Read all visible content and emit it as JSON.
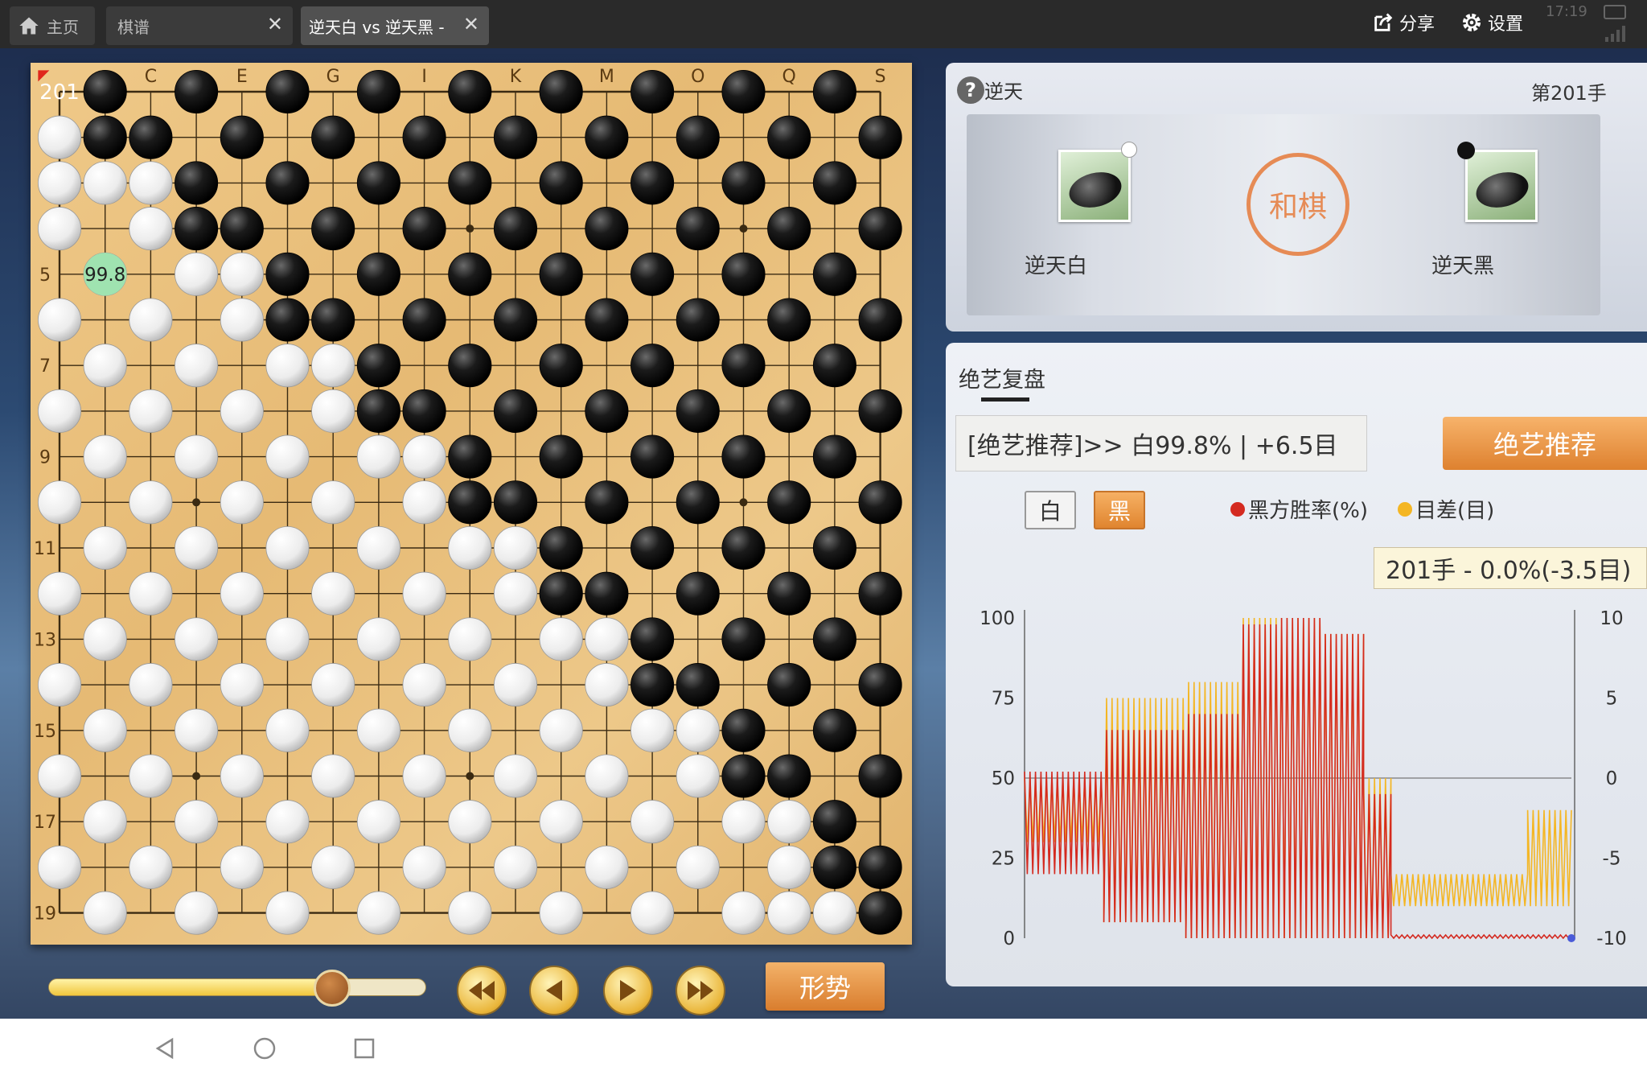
{
  "tabs": [
    {
      "label": "主页"
    },
    {
      "label": "棋谱"
    },
    {
      "label": "逆天白 vs 逆天黑 -"
    }
  ],
  "topbar": {
    "share_label": "分享",
    "settings_label": "设置",
    "clock": "17:19"
  },
  "board": {
    "col_labels": [
      "C",
      "E",
      "G",
      "I",
      "K",
      "M",
      "O",
      "Q",
      "S"
    ],
    "row_labels": [
      "5",
      "7",
      "9",
      "11",
      "13",
      "15",
      "17",
      "19"
    ],
    "move_number_label": "201",
    "winrate_marker": "99.8",
    "winrate_marker_point": "B5",
    "rows": [
      ".B.B.B.B.B.B.B.B.B.",
      "WBB.B.B.B.B.B.B.B.B",
      "WWWB.B.B.B.B.B.B.B.",
      "W.WBB.B.B.B.B.B.B.B",
      ".W.WWB.B.B.B.B.B.B.",
      "W.W.WBB.B.B.B.B.B.B",
      ".W.W.WWB.B.B.B.B.B.",
      "W.W.W.WBB.B.B.B.B.B",
      ".W.W.W.WWB.B.B.B.B.",
      "W.W.W.W.WBB.B.B.B.B",
      ".W.W.W.W.WWB.B.B.B.",
      "W.W.W.W.W.WBB.B.B.B",
      ".W.W.W.W.W.WWB.B.B.",
      "W.W.W.W.W.W.WBB.B.B",
      ".W.W.W.W.W.W.WWB.B.",
      "W.W.W.W.W.W.W.WBB.B",
      ".W.W.W.W.W.W.W.WWB.",
      "W.W.W.W.W.W.W.W.WBB",
      ".W.W.W.W.W.W.W.WWWB"
    ]
  },
  "info": {
    "help_label": "逆天",
    "move_label": "第201手",
    "white_player": "逆天白",
    "black_player": "逆天黑",
    "result": "和棋"
  },
  "playback": {
    "progress": 0.75,
    "trend_label": "形势"
  },
  "review": {
    "title": "绝艺复盘",
    "recommend_text": "[绝艺推荐]>> 白99.8% | +6.5目",
    "recommend_button": "绝艺推荐",
    "white_button": "白",
    "black_button": "黑",
    "legend_winrate": "黑方胜率(%)",
    "legend_diff": "目差(目)",
    "tooltip": "201手 - 0.0%(-3.5目)"
  },
  "chart_data": {
    "type": "line",
    "y_left": {
      "ticks": [
        100,
        75,
        50,
        25,
        0
      ],
      "range": [
        0,
        100
      ]
    },
    "y_right": {
      "ticks": [
        10,
        5,
        0,
        -5,
        -10
      ],
      "range": [
        -10,
        10
      ]
    },
    "x_range": [
      1,
      201
    ],
    "series": [
      {
        "name": "黑方胜率(%)",
        "color": "#d42a20",
        "segments": [
          [
            1,
            201,
            1,
            40
          ],
          [
            1,
            30,
            20,
            52
          ],
          [
            30,
            60,
            5,
            65
          ],
          [
            60,
            80,
            0,
            70
          ],
          [
            80,
            95,
            0,
            98
          ],
          [
            95,
            110,
            0,
            100
          ],
          [
            110,
            125,
            0,
            95
          ],
          [
            125,
            135,
            0,
            45
          ],
          [
            135,
            201,
            0,
            1
          ]
        ]
      },
      {
        "name": "目差(目)",
        "color": "#f4b623",
        "segments": [
          [
            1,
            30,
            -4,
            0
          ],
          [
            30,
            60,
            -9,
            5
          ],
          [
            60,
            80,
            -10,
            6
          ],
          [
            80,
            110,
            -10,
            10
          ],
          [
            110,
            125,
            -10,
            9
          ],
          [
            125,
            135,
            -10,
            0
          ],
          [
            135,
            185,
            -8,
            -6
          ],
          [
            185,
            201,
            -8,
            -2
          ]
        ]
      }
    ],
    "colors": {
      "winrate": "#d42a20",
      "diff": "#f4b623"
    }
  },
  "sysnav": {
    "back": "back-icon",
    "home": "home-circle-icon",
    "recent": "recent-apps-icon"
  }
}
